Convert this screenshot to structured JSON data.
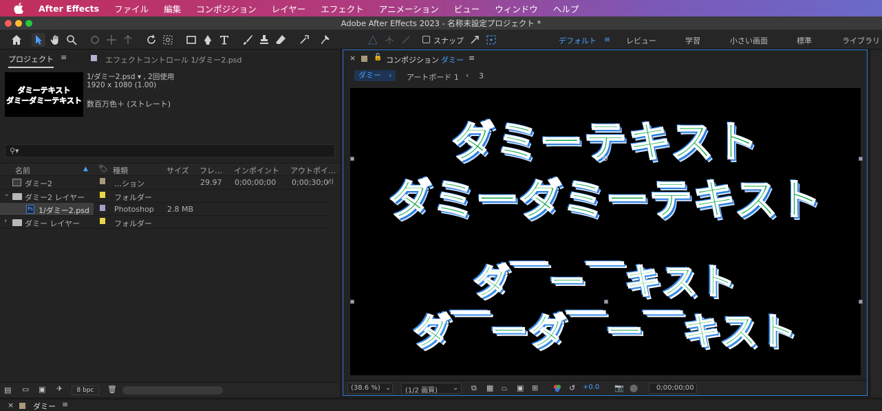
{
  "menubar": {
    "app_name": "After Effects",
    "items": [
      "ファイル",
      "編集",
      "コンポジション",
      "レイヤー",
      "エフェクト",
      "アニメーション",
      "ビュー",
      "ウィンドウ",
      "ヘルプ"
    ]
  },
  "window": {
    "title": "Adobe After Effects 2023 - 名称未設定プロジェクト *"
  },
  "toolbar": {
    "snap_label": "スナップ",
    "workspaces": [
      "デフォルト",
      "レビュー",
      "学習",
      "小さい画面",
      "標準",
      "ライブラリ"
    ]
  },
  "project_panel": {
    "tab_label": "プロジェクト",
    "effect_controls_label": "エフェクトコントロール 1/ダミー2.psd",
    "info": {
      "name_line": "1/ダミー2.psd ▾ , 2回使用",
      "dims_line": "1920 x 1080 (1.00)",
      "color_line": "数百万色＋ (ストレート)"
    },
    "thumb_text": [
      "ダミーテキスト",
      "ダミーダミーテキスト"
    ],
    "search_placeholder": "",
    "columns": [
      "名前",
      "種類",
      "サイズ",
      "フレ…",
      "インポイント",
      "アウトポイ…"
    ],
    "rows": [
      {
        "name": "ダミー2",
        "type": "…ション",
        "size": "",
        "fps": "29.97",
        "in": "0;00;00;00",
        "out": "0;00;30;0",
        "swatch": "#a89a7a"
      },
      {
        "name": "ダミー2 レイヤー",
        "type": "フォルダー",
        "size": "",
        "fps": "",
        "in": "",
        "out": "",
        "swatch": "#e8d64a"
      },
      {
        "name": "1/ダミー2.psd",
        "type": "Photoshop",
        "size": "2.8 MB",
        "fps": "",
        "in": "",
        "out": "",
        "swatch": "#a99cc8"
      },
      {
        "name": "ダミー レイヤー",
        "type": "フォルダー",
        "size": "",
        "fps": "",
        "in": "",
        "out": "",
        "swatch": "#e8d64a"
      }
    ],
    "bpc_label": "8 bpc"
  },
  "comp_panel": {
    "tab_prefix": "コンポジション",
    "tab_comp_name": "ダミー",
    "breadcrumb": [
      "ダミー",
      "アートボード 1",
      "3"
    ],
    "canvas_text": {
      "line1": "ダミーテキスト",
      "line2": "ダミーダミーテキスト",
      "line3": "ダ￣ー￣キスト",
      "line4": "ダ￣ーダ￣ー￣キスト"
    },
    "zoom": "(38.6 %)",
    "resolution": "(1/2 画質)",
    "exposure": "+0.0",
    "timecode": "0;00;00;00"
  },
  "timeline": {
    "tab_label": "ダミー"
  },
  "colors": {
    "accent_blue": "#2f7ad8",
    "text_green": "#12a84a"
  }
}
